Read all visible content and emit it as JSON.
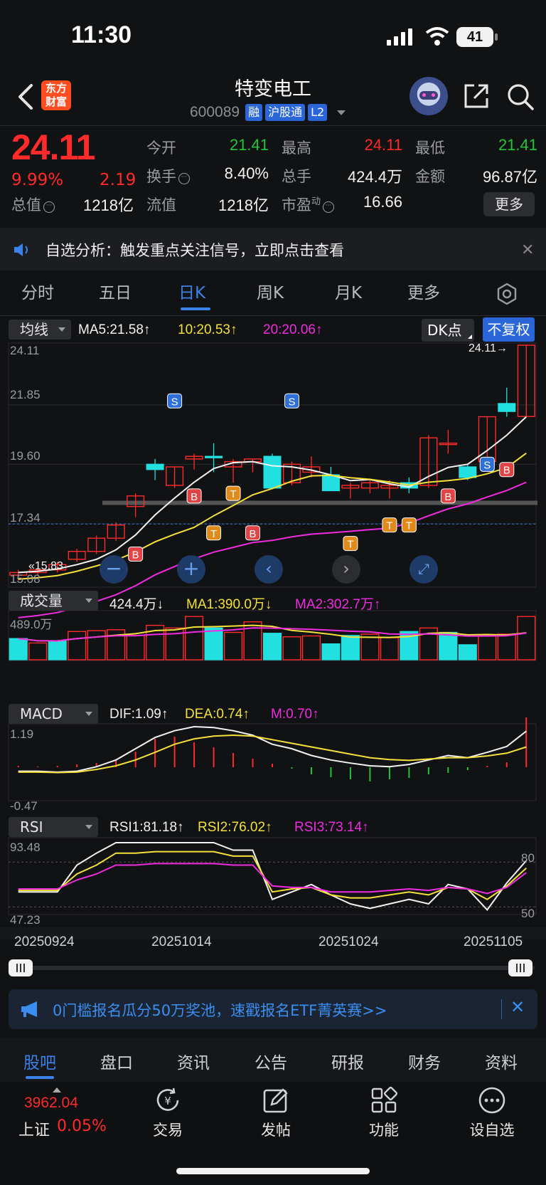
{
  "status_bar": {
    "time": "11:30",
    "battery": "41"
  },
  "header": {
    "app_logo": [
      "东方",
      "财富"
    ],
    "stock_name": "特变电工",
    "stock_code": "600089",
    "tags": [
      "融",
      "沪股通",
      "L2"
    ]
  },
  "quote": {
    "price": "24.11",
    "change_pct": "9.99%",
    "change": "2.19",
    "fields": [
      {
        "label": "今开",
        "value": "21.41",
        "color": "green"
      },
      {
        "label": "最高",
        "value": "24.11",
        "color": "red"
      },
      {
        "label": "最低",
        "value": "21.41",
        "color": "green"
      },
      {
        "label": "换手",
        "value": "8.40%",
        "color": "white"
      },
      {
        "label": "总手",
        "value": "424.4万",
        "color": "white"
      },
      {
        "label": "金额",
        "value": "96.87亿",
        "color": "white"
      },
      {
        "label": "总值",
        "value": "1218亿",
        "color": "white"
      },
      {
        "label": "流值",
        "value": "1218亿",
        "color": "white"
      },
      {
        "label": "市盈",
        "label_sup": "动",
        "value": "16.66",
        "color": "white"
      }
    ],
    "more_label": "更多"
  },
  "alert": {
    "text": "自选分析：触发重点关注信号，立即点击查看"
  },
  "period_tabs": [
    "分时",
    "五日",
    "日K",
    "周K",
    "月K",
    "更多"
  ],
  "active_period": "日K",
  "kline": {
    "selector": "均线",
    "ma5": "MA5:21.58",
    "ma10": "10:20.53",
    "ma20": "20:20.06",
    "dk_label": "DK点",
    "fq_label": "不复权",
    "y_labels": [
      "24.11",
      "21.85",
      "19.60",
      "17.34",
      "15.08"
    ],
    "last_price_tag": "24.11→",
    "low_tag": "15.83",
    "markers": {
      "S": "S",
      "B": "B",
      "T": "T"
    }
  },
  "volume": {
    "selector": "成交量",
    "vol": "424.4万",
    "ma1": "MA1:390.0万",
    "ma2": "MA2:302.7万",
    "top_label": "489.0万"
  },
  "macd": {
    "selector": "MACD",
    "dif": "DIF:1.09",
    "dea": "DEA:0.74",
    "m": "M:0.70",
    "top_label": "1.19",
    "bottom_label": "-0.47"
  },
  "rsi": {
    "selector": "RSI",
    "rsi1": "RSI1:81.18",
    "rsi2": "RSI2:76.02",
    "rsi3": "RSI3:73.14",
    "top_label": "93.48",
    "bottom_label": "47.23",
    "level_80": "80",
    "level_50": "50"
  },
  "dates": [
    "20250924",
    "20251014",
    "20251024",
    "20251105"
  ],
  "promo": {
    "text": "0门槛报名瓜分50万奖池，速戳报名ETF菁英赛>>"
  },
  "bottom_tabs": [
    "股吧",
    "盘口",
    "资讯",
    "公告",
    "研报",
    "财务",
    "资料"
  ],
  "toolbar": {
    "index_value": "3962.04",
    "index_name": "上证",
    "index_pct": "0.05%",
    "items": [
      "交易",
      "发帖",
      "功能",
      "设自选"
    ]
  },
  "colors": {
    "up": "#ff2a2a",
    "down": "#22c53a",
    "accent": "#3b82e8",
    "ma5": "#f2f2f2",
    "ma10": "#f3e13a",
    "ma20": "#f02ce0",
    "cyan": "#22e0e0"
  },
  "chart_data": {
    "type": "candlestick",
    "candles": [
      {
        "o": 15.4,
        "h": 15.6,
        "l": 15.2,
        "c": 15.5,
        "up": true
      },
      {
        "o": 15.5,
        "h": 15.7,
        "l": 15.4,
        "c": 15.6,
        "up": true
      },
      {
        "o": 15.6,
        "h": 15.9,
        "l": 15.5,
        "c": 15.8,
        "up": true
      },
      {
        "o": 16.0,
        "h": 16.4,
        "l": 15.9,
        "c": 16.3,
        "up": true
      },
      {
        "o": 16.3,
        "h": 16.9,
        "l": 16.2,
        "c": 16.8,
        "up": true
      },
      {
        "o": 16.8,
        "h": 17.4,
        "l": 16.7,
        "c": 17.3,
        "up": true
      },
      {
        "o": 18.0,
        "h": 18.5,
        "l": 17.6,
        "c": 18.4,
        "up": true
      },
      {
        "o": 19.4,
        "h": 19.8,
        "l": 19.0,
        "c": 19.6,
        "up": false
      },
      {
        "o": 18.8,
        "h": 19.5,
        "l": 18.7,
        "c": 19.5,
        "up": true
      },
      {
        "o": 19.9,
        "h": 20.0,
        "l": 19.4,
        "c": 19.8,
        "up": true
      },
      {
        "o": 19.9,
        "h": 20.4,
        "l": 19.3,
        "c": 19.9,
        "up": false
      },
      {
        "o": 19.7,
        "h": 19.8,
        "l": 18.9,
        "c": 19.5,
        "up": true
      },
      {
        "o": 19.7,
        "h": 19.8,
        "l": 19.3,
        "c": 19.8,
        "up": true
      },
      {
        "o": 19.9,
        "h": 20.0,
        "l": 19.0,
        "c": 18.7,
        "up": false
      },
      {
        "o": 18.9,
        "h": 19.7,
        "l": 18.8,
        "c": 19.6,
        "up": true
      },
      {
        "o": 19.5,
        "h": 19.9,
        "l": 19.1,
        "c": 19.3,
        "up": true
      },
      {
        "o": 19.2,
        "h": 19.5,
        "l": 18.6,
        "c": 18.6,
        "up": false
      },
      {
        "o": 18.8,
        "h": 18.9,
        "l": 18.3,
        "c": 18.7,
        "up": true
      },
      {
        "o": 18.7,
        "h": 19.0,
        "l": 18.5,
        "c": 18.9,
        "up": true
      },
      {
        "o": 18.7,
        "h": 19.0,
        "l": 18.3,
        "c": 18.8,
        "up": true
      },
      {
        "o": 18.9,
        "h": 19.1,
        "l": 18.5,
        "c": 18.7,
        "up": false
      },
      {
        "o": 18.8,
        "h": 20.7,
        "l": 18.7,
        "c": 20.6,
        "up": true
      },
      {
        "o": 20.4,
        "h": 20.9,
        "l": 20.0,
        "c": 20.4,
        "up": true
      },
      {
        "o": 19.1,
        "h": 19.6,
        "l": 19.0,
        "c": 19.5,
        "up": false
      },
      {
        "o": 19.7,
        "h": 21.4,
        "l": 19.6,
        "c": 21.4,
        "up": true
      },
      {
        "o": 21.9,
        "h": 22.5,
        "l": 21.4,
        "c": 21.6,
        "up": false
      },
      {
        "o": 21.41,
        "h": 24.11,
        "l": 21.41,
        "c": 24.11,
        "up": true
      }
    ],
    "volume": [
      0.48,
      0.38,
      0.42,
      0.64,
      0.66,
      0.68,
      0.55,
      0.78,
      0.72,
      0.98,
      0.72,
      0.62,
      0.86,
      0.6,
      0.52,
      0.54,
      0.36,
      0.55,
      0.58,
      0.5,
      0.64,
      0.72,
      0.62,
      0.34,
      0.54,
      0.58,
      0.98
    ],
    "volume_colors": [
      "c",
      "r",
      "c",
      "r",
      "r",
      "r",
      "r",
      "r",
      "r",
      "r",
      "c",
      "r",
      "r",
      "c",
      "r",
      "r",
      "c",
      "c",
      "r",
      "r",
      "c",
      "r",
      "c",
      "c",
      "r",
      "r",
      "r"
    ],
    "macd_hist": [
      0.02,
      0.01,
      0.02,
      0.04,
      0.06,
      0.1,
      0.22,
      0.4,
      0.43,
      0.35,
      0.28,
      0.2,
      0.12,
      0.05,
      -0.02,
      -0.1,
      -0.14,
      -0.17,
      -0.2,
      -0.17,
      -0.15,
      -0.1,
      -0.08,
      -0.04,
      0.02,
      0.07,
      0.7
    ],
    "dates": [
      "20250924",
      "20251014",
      "20251024",
      "20251105"
    ]
  }
}
